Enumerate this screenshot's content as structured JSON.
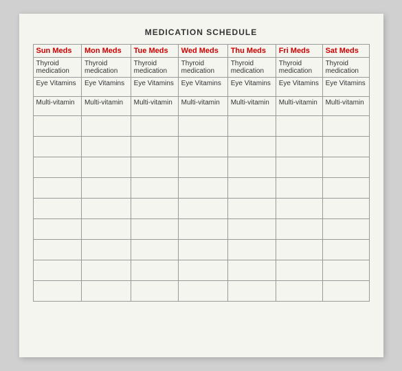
{
  "title": "MEDICATION SCHEDULE",
  "columns": [
    "Sun Meds",
    "Mon Meds",
    "Tue Meds",
    "Wed Meds",
    "Thu Meds",
    "Fri Meds",
    "Sat Meds"
  ],
  "rows": [
    [
      "Thyroid medication",
      "Thyroid medication",
      "Thyroid medication",
      "Thyroid medication",
      "Thyroid medication",
      "Thyroid medication",
      "Thyroid medication"
    ],
    [
      "Eye Vitamins",
      "Eye Vitamins",
      "Eye Vitamins",
      "Eye Vitamins",
      "Eye Vitamins",
      "Eye Vitamins",
      "Eye Vitamins"
    ],
    [
      "Multi-vitamin",
      "Multi-vitamin",
      "Multi-vitamin",
      "Multi-vitamin",
      "Multi-vitamin",
      "Multi-vitamin",
      "Multi-vitamin"
    ],
    [
      "",
      "",
      "",
      "",
      "",
      "",
      ""
    ],
    [
      "",
      "",
      "",
      "",
      "",
      "",
      ""
    ],
    [
      "",
      "",
      "",
      "",
      "",
      "",
      ""
    ],
    [
      "",
      "",
      "",
      "",
      "",
      "",
      ""
    ],
    [
      "",
      "",
      "",
      "",
      "",
      "",
      ""
    ],
    [
      "",
      "",
      "",
      "",
      "",
      "",
      ""
    ],
    [
      "",
      "",
      "",
      "",
      "",
      "",
      ""
    ],
    [
      "",
      "",
      "",
      "",
      "",
      "",
      ""
    ],
    [
      "",
      "",
      "",
      "",
      "",
      "",
      ""
    ]
  ]
}
